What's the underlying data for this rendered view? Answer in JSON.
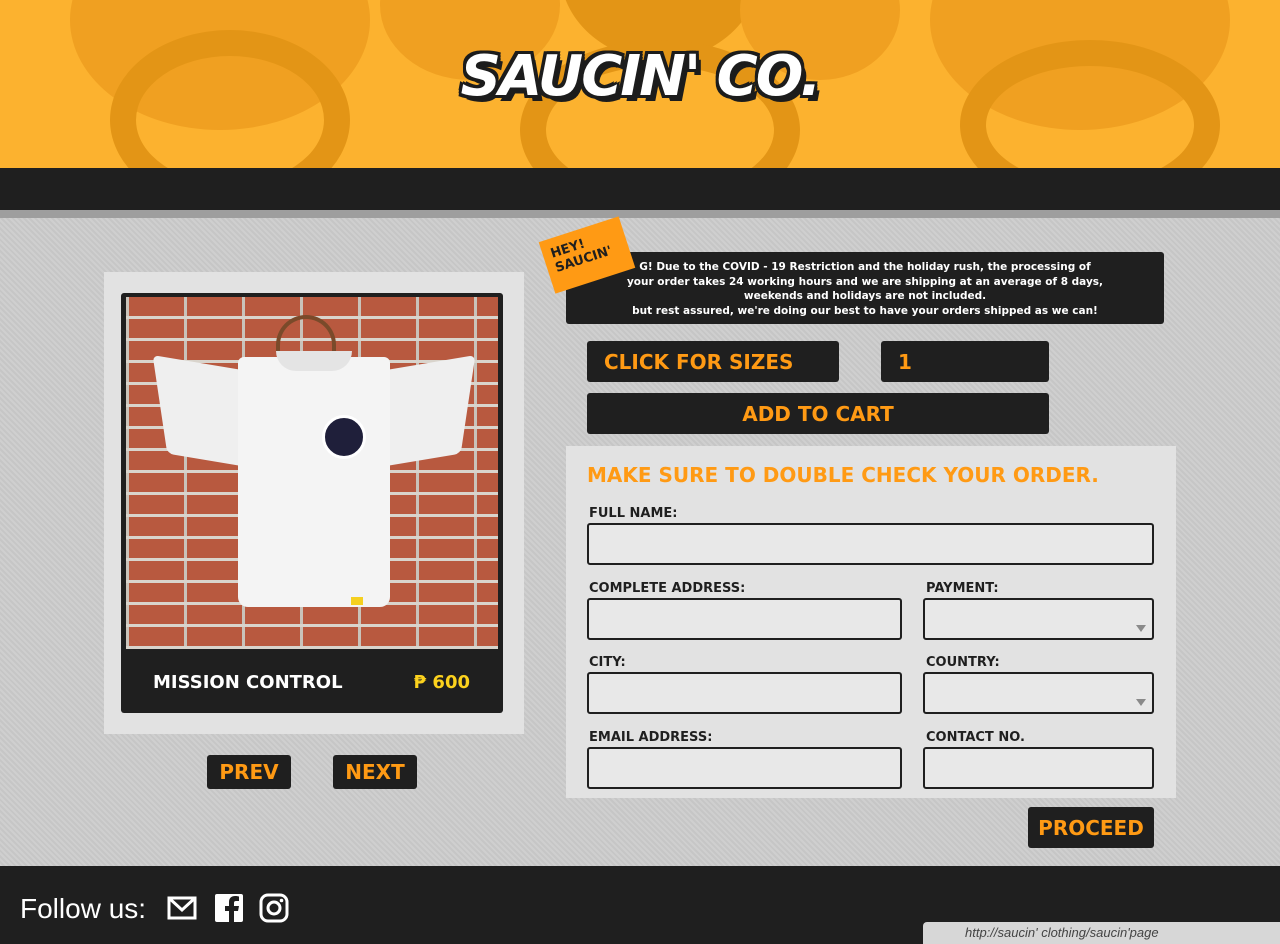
{
  "brand": {
    "logo_text": "SAUCIN' CO."
  },
  "notice": {
    "badge_line1": "HEY!",
    "badge_line2": "SAUCIN'",
    "lines": [
      "G! Due to the COVID - 19 Restriction and the holiday rush, the processing of",
      "your order takes 24 working hours and we are shipping at an average of 8 days,",
      "weekends and holidays are not included.",
      "but rest assured, we're doing our best to have your orders shipped as we can!"
    ]
  },
  "product": {
    "name": "MISSION CONTROL",
    "price": "₱ 600",
    "prev_label": "PREV",
    "next_label": "NEXT"
  },
  "order": {
    "sizes_label": "CLICK FOR SIZES",
    "quantity": "1",
    "add_to_cart_label": "ADD TO CART"
  },
  "form": {
    "title": "MAKE SURE TO DOUBLE CHECK YOUR ORDER.",
    "full_name_label": "FULL NAME:",
    "address_label": "COMPLETE ADDRESS:",
    "payment_label": "PAYMENT:",
    "city_label": "CITY:",
    "country_label": "COUNTRY:",
    "email_label": "EMAIL ADDRESS:",
    "contact_label": "CONTACT NO.",
    "proceed_label": "PROCEED"
  },
  "footer": {
    "follow_label": "Follow us:",
    "status_url": "http://saucin' clothing/saucin'page"
  },
  "colors": {
    "accent": "#ff9a14",
    "header_yellow": "#fcb22f",
    "dark": "#1f1f1f",
    "price_yellow": "#fcd21d"
  },
  "icons": [
    "mail-icon",
    "facebook-icon",
    "instagram-icon"
  ]
}
